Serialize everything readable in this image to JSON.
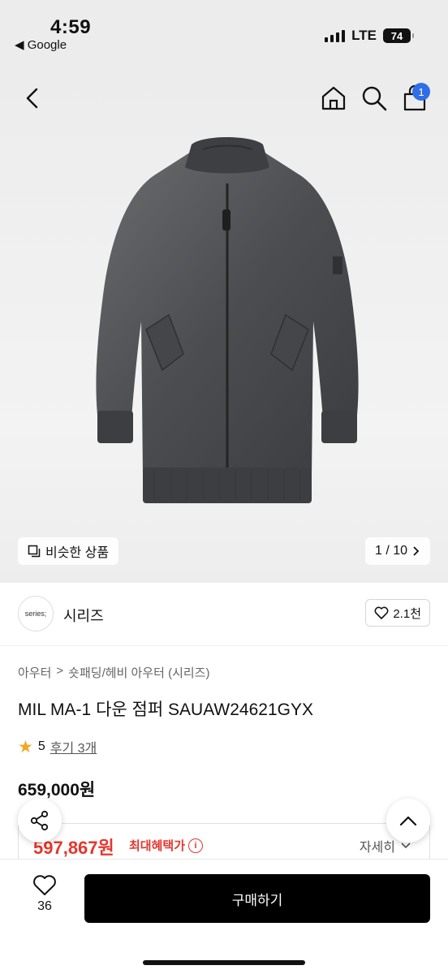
{
  "status_bar": {
    "time": "4:59",
    "back_app": "◀ Google",
    "network": "LTE",
    "battery": "74"
  },
  "hero": {
    "similar_label": "비슷한 상품",
    "pager": "1 / 10",
    "cart_count": "1"
  },
  "brand": {
    "logo_text": "series;",
    "name": "시리즈",
    "like_count": "2.1천"
  },
  "breadcrumb": {
    "level1": "아우터",
    "separator": ">",
    "level2": "숏패딩/헤비 아우터 (시리즈)"
  },
  "product": {
    "title": "MIL MA-1 다운 점퍼 SAUAW24621GYX",
    "rating": "5",
    "reviews": "후기 3개",
    "price": "659,000원"
  },
  "benefit": {
    "price": "597,867원",
    "label": "최대혜택가",
    "detail": "자세히"
  },
  "bottom_bar": {
    "favorite_count": "36",
    "buy_label": "구매하기"
  },
  "icons": {
    "back": "chevron-left-icon",
    "home": "home-icon",
    "search": "search-icon",
    "cart": "shopping-bag-icon",
    "share": "share-icon",
    "top": "chevron-up-icon",
    "heart": "heart-icon",
    "star": "star-icon"
  },
  "colors": {
    "accent_blue": "#2f6ee8",
    "sale_red": "#e6362c",
    "star": "#f5a623",
    "button_black": "#000000"
  }
}
